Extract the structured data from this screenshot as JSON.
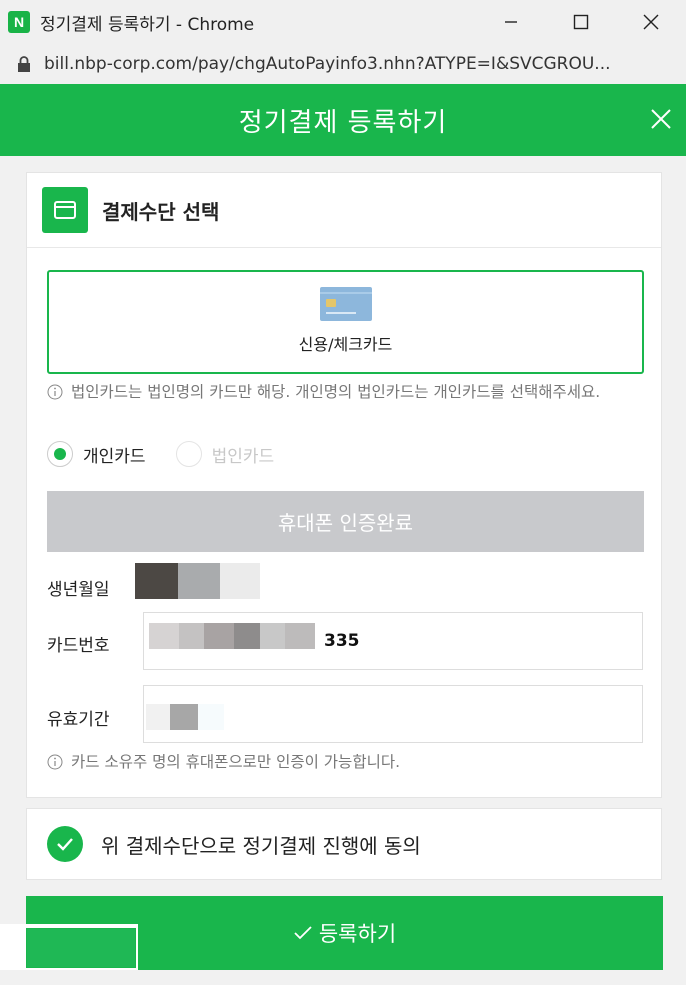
{
  "window": {
    "logo_letter": "N",
    "title": "정기결제 등록하기 - Chrome",
    "url": "bill.nbp-corp.com/pay/chgAutoPayinfo3.nhn?ATYPE=I&SVCGROU..."
  },
  "header": {
    "title": "정기결제 등록하기"
  },
  "payment_section": {
    "title": "결제수단 선택",
    "method_label": "신용/체크카드",
    "notice": "법인카드는 법인명의 카드만 해당. 개인명의 법인카드는 개인카드를 선택해주세요.",
    "radios": [
      {
        "label": "개인카드",
        "selected": true,
        "disabled": false
      },
      {
        "label": "법인카드",
        "selected": false,
        "disabled": true
      }
    ],
    "verify_button": "휴대폰 인증완료",
    "birth_label": "생년월일",
    "card_number_label": "카드번호",
    "card_number_suffix": "335",
    "expiry_label": "유효기간",
    "phone_notice": "카드 소유주 명의 휴대폰으로만 인증이 가능합니다."
  },
  "agree": {
    "text": "위 결제수단으로 정기결제 진행에 동의",
    "checked": true
  },
  "submit": {
    "label": "등록하기"
  },
  "colors": {
    "brand_green": "#19b64c",
    "disabled_button": "#c8c9cc"
  }
}
